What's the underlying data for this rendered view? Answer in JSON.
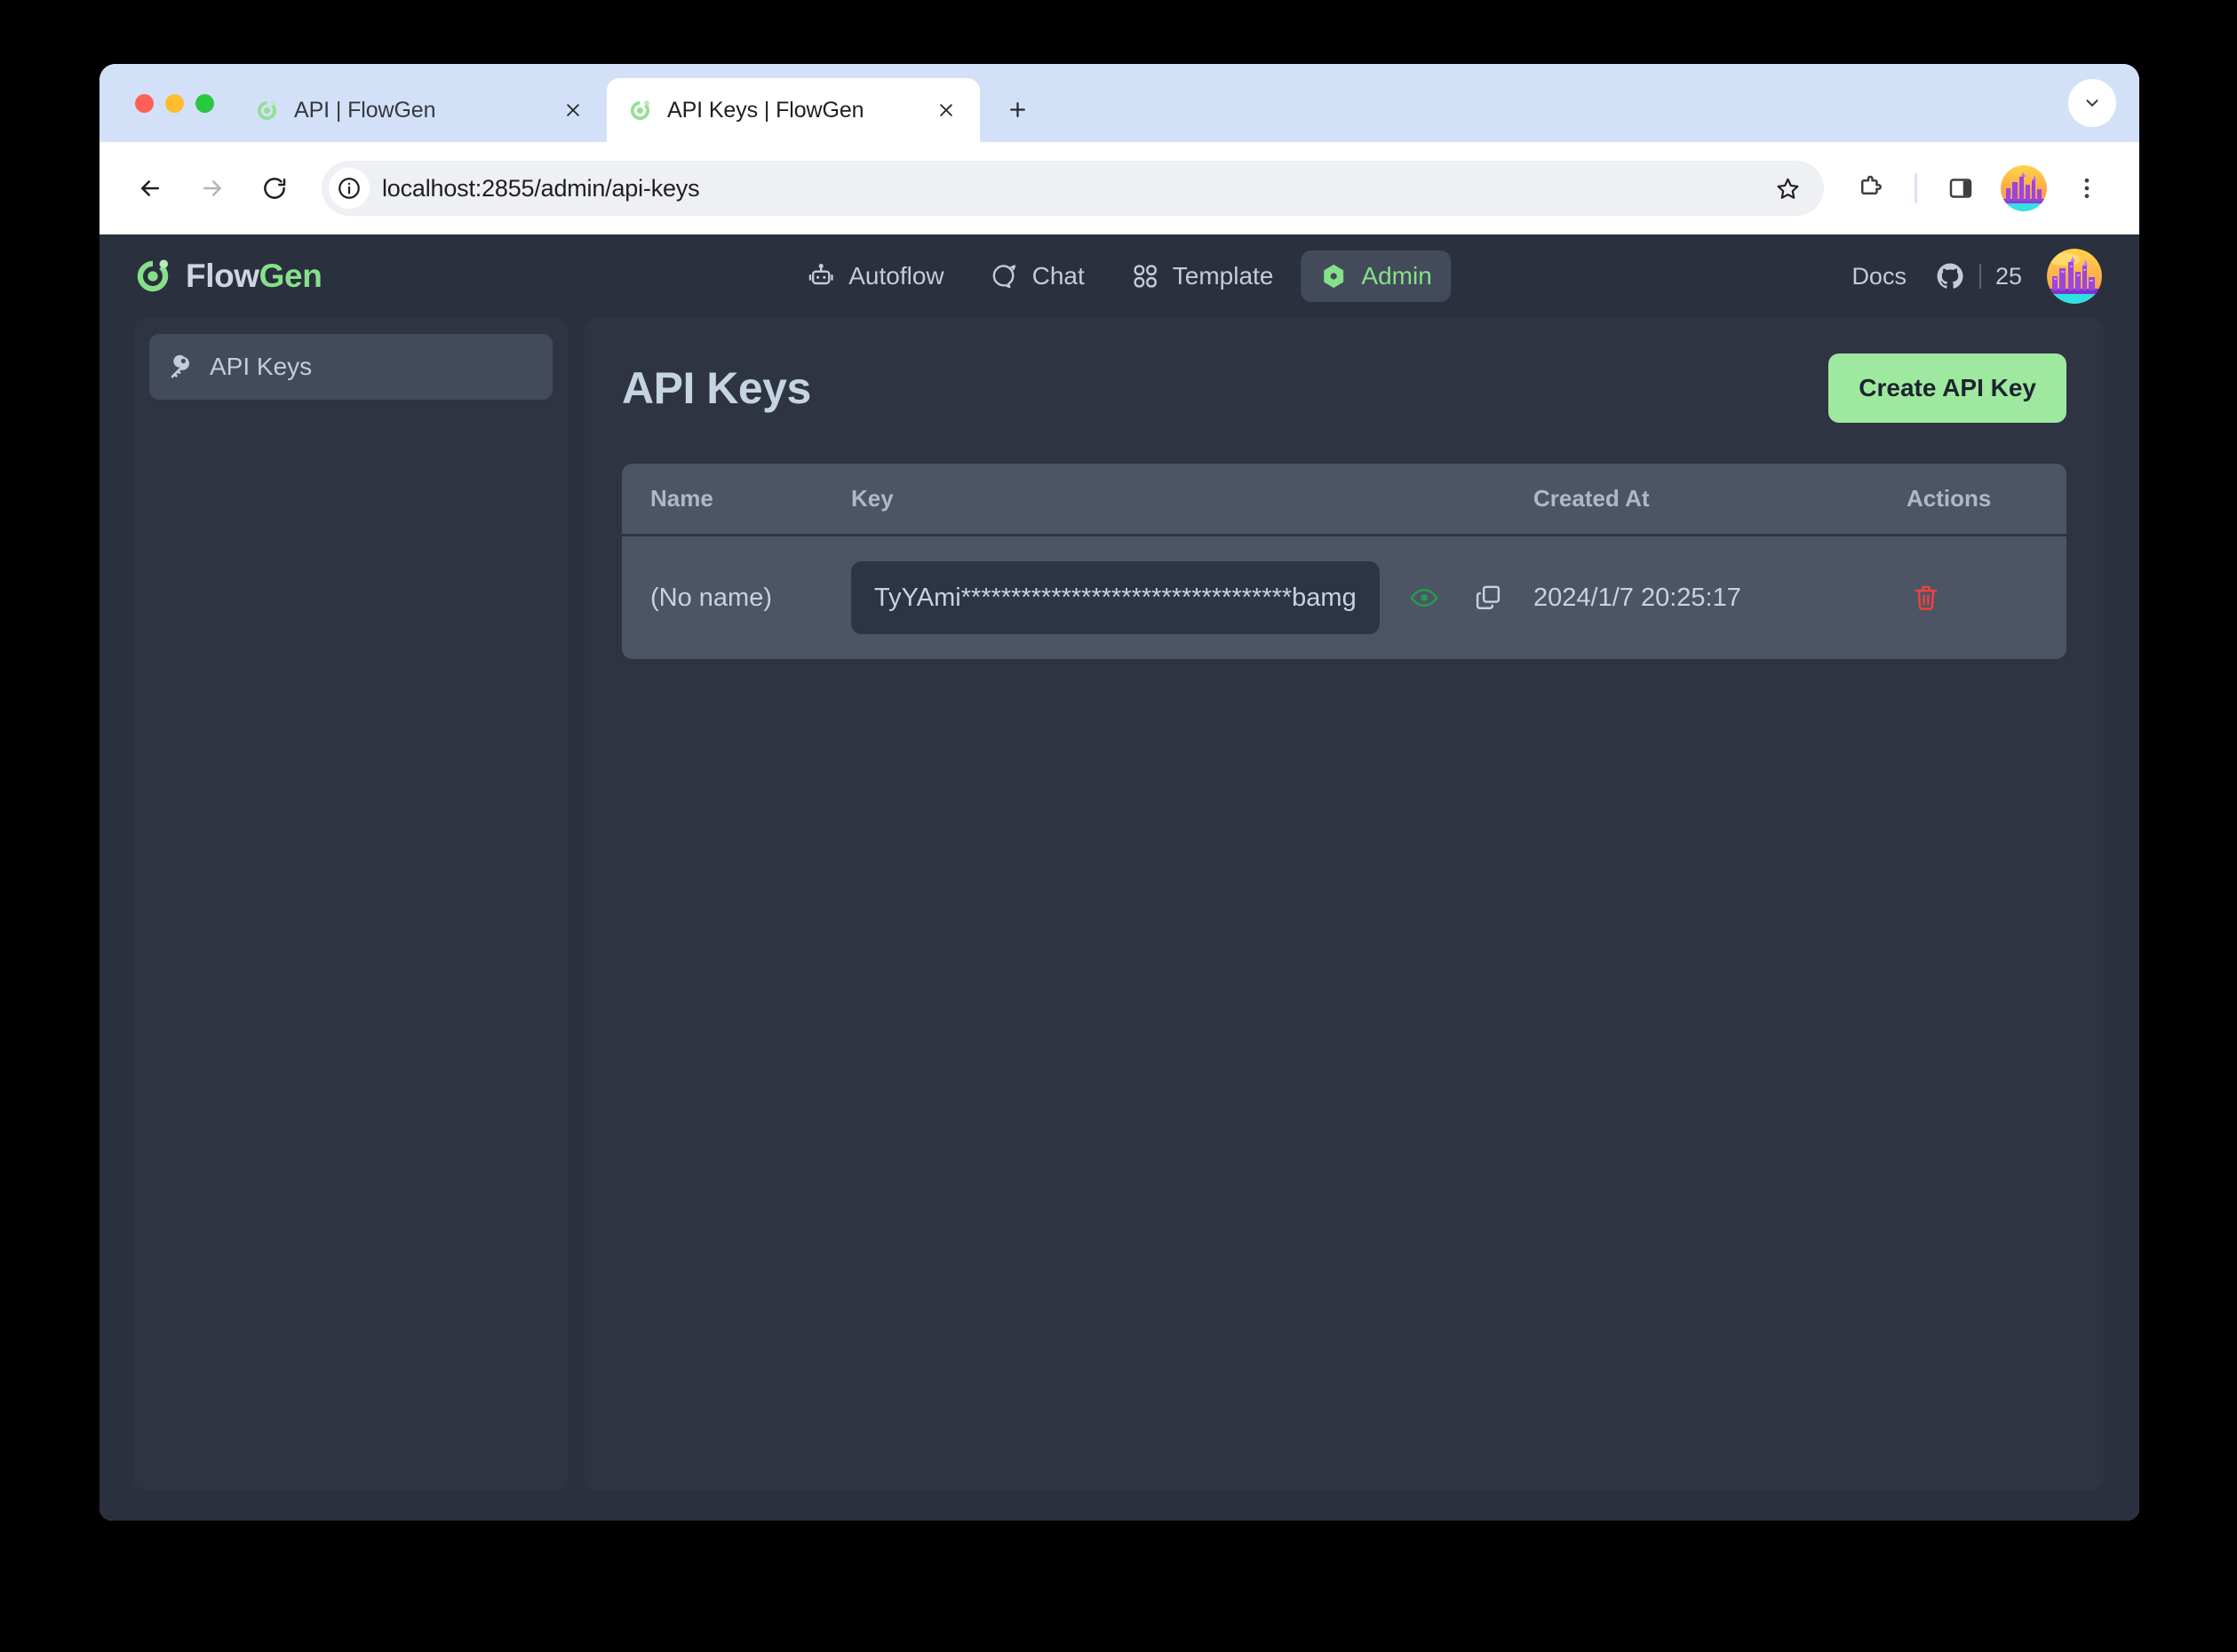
{
  "browser": {
    "tabs": [
      {
        "title": "API | FlowGen",
        "active": false,
        "favicon": "flowgen-favicon"
      },
      {
        "title": "API Keys | FlowGen",
        "active": true,
        "favicon": "flowgen-favicon"
      }
    ],
    "new_tab_label": "+",
    "url": "localhost:2855/admin/api-keys",
    "toolbar_icons": [
      "back-arrow-icon",
      "forward-arrow-icon",
      "reload-icon",
      "site-info-icon",
      "bookmark-star-icon",
      "extensions-puzzle-icon",
      "side-panel-icon",
      "profile-avatar-icon",
      "more-menu-icon"
    ]
  },
  "app": {
    "brand": {
      "flow": "Flow",
      "gen": "Gen"
    },
    "nav": [
      {
        "label": "Autoflow",
        "icon": "robot-icon",
        "active": false
      },
      {
        "label": "Chat",
        "icon": "chat-bubble-icon",
        "active": false
      },
      {
        "label": "Template",
        "icon": "grid-apps-icon",
        "active": false
      },
      {
        "label": "Admin",
        "icon": "hexagon-gem-icon",
        "active": true
      }
    ],
    "nav_right": {
      "docs_label": "Docs",
      "github_icon": "github-icon",
      "star_count": "25"
    },
    "sidebar": {
      "items": [
        {
          "label": "API Keys",
          "icon": "key-icon",
          "active": true
        }
      ]
    },
    "main": {
      "title": "API Keys",
      "create_button": "Create API Key",
      "table": {
        "columns": [
          "Name",
          "Key",
          "Created At",
          "Actions"
        ],
        "rows": [
          {
            "name": "(No name)",
            "key": "TyYAmi*********************************bamg",
            "created_at": "2024/1/7 20:25:17",
            "row_icons": [
              "eye-icon",
              "copy-icon",
              "trash-icon"
            ]
          }
        ]
      }
    }
  },
  "colors": {
    "page_bg": "#2a303d",
    "panel_bg": "#2e3442",
    "table_bg": "#4d5564",
    "accent_green": "#9fe89f",
    "brand_green": "#86e08a",
    "danger_red": "#f0433f",
    "eye_green": "#1f9e4f",
    "text_primary": "#c4d4e0",
    "tabstrip_bg": "#d3e1f8"
  }
}
